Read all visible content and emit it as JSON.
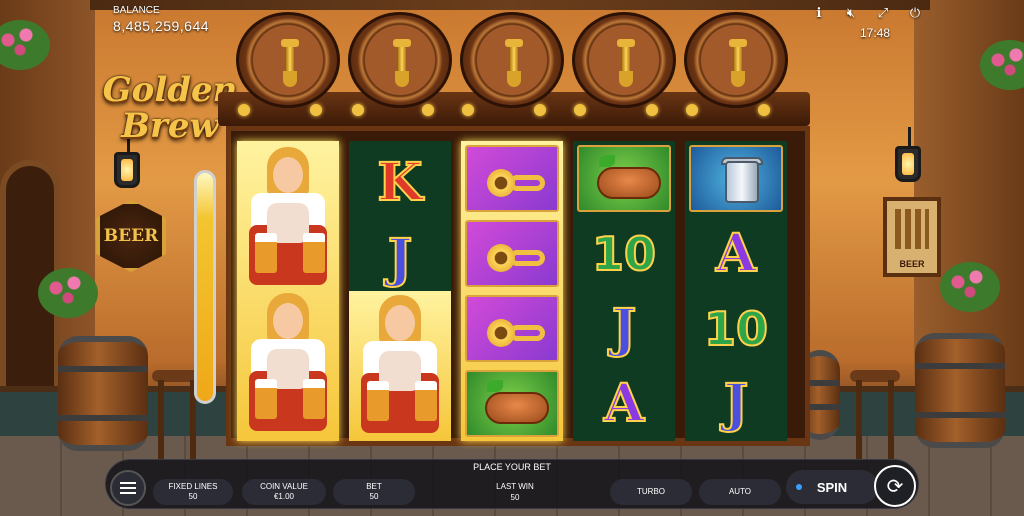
{
  "balance": {
    "label": "BALANCE",
    "value": "8,485,259,644"
  },
  "top_icons": [
    "info-icon",
    "sound-muted-icon",
    "fullscreen-icon",
    "power-icon"
  ],
  "clock": "17:48",
  "logo": {
    "line1": "Golden",
    "line2": "Brew"
  },
  "beer_sign": "BEER",
  "poster_label": "BEER",
  "reels": [
    [
      "barmaid",
      "barmaid",
      "barmaid"
    ],
    [
      "K",
      "J",
      "barmaid"
    ],
    [
      "horn",
      "horn",
      "horn",
      "sausage"
    ],
    [
      "sausage",
      "10",
      "J",
      "A"
    ],
    [
      "stein",
      "A",
      "10",
      "J"
    ]
  ],
  "controls": {
    "place_your_bet": "PLACE YOUR BET",
    "fixed_lines": {
      "label": "FIXED LINES",
      "value": "50"
    },
    "coin_value": {
      "label": "COIN VALUE",
      "value": "€1.00"
    },
    "bet": {
      "label": "BET",
      "value": "50"
    },
    "last_win": {
      "label": "LAST WIN",
      "value": "50"
    },
    "turbo": "TURBO",
    "auto": "AUTO",
    "spin": "SPIN"
  },
  "colors": {
    "gold": "#f7c44a",
    "reel_green": "#0f3b22",
    "bar_bg": "#14141a",
    "spin_accent": "#3aa0ff"
  }
}
